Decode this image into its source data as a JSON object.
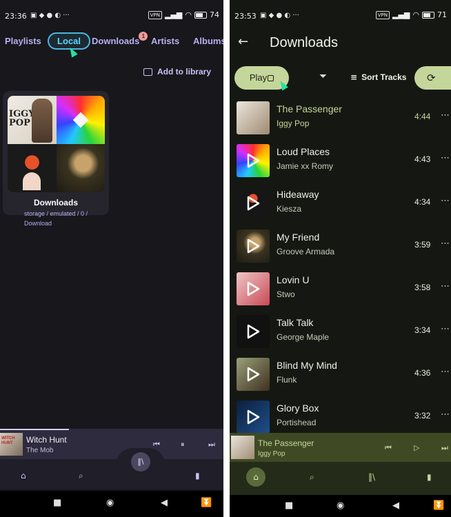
{
  "left": {
    "status": {
      "time": "23:36",
      "battery": "74"
    },
    "tabs": [
      {
        "label": "Playlists"
      },
      {
        "label": "Local"
      },
      {
        "label": "Downloads",
        "badge": "1"
      },
      {
        "label": "Artists"
      },
      {
        "label": "Albums"
      }
    ],
    "add_to_library": "Add to library",
    "folder": {
      "title": "Downloads",
      "path": "storage / emulated / 0 / Download"
    },
    "now_playing": {
      "title": "Witch Hunt",
      "artist": "The Mob"
    }
  },
  "right": {
    "status": {
      "time": "23:53",
      "battery": "71"
    },
    "title": "Downloads",
    "play_label": "Play",
    "sort_label": "Sort Tracks",
    "tracks": [
      {
        "title": "The Passenger",
        "artist": "Iggy Pop",
        "duration": "4:44"
      },
      {
        "title": "Loud Places",
        "artist": "Jamie xx  Romy",
        "duration": "4:43"
      },
      {
        "title": "Hideaway",
        "artist": "Kiesza",
        "duration": "4:34"
      },
      {
        "title": "My Friend",
        "artist": "Groove Armada",
        "duration": "3:59"
      },
      {
        "title": "Lovin U",
        "artist": "Stwo",
        "duration": "3:58"
      },
      {
        "title": "Talk Talk",
        "artist": "George Maple",
        "duration": "3:34"
      },
      {
        "title": "Blind My Mind",
        "artist": "Flunk",
        "duration": "4:36"
      },
      {
        "title": "Glory Box",
        "artist": "Portishead",
        "duration": "3:32"
      }
    ],
    "now_playing": {
      "title": "The Passenger",
      "artist": "Iggy Pop"
    }
  },
  "colors": {
    "left_accent": "#5ad8ff",
    "right_accent": "#c5d69a"
  }
}
